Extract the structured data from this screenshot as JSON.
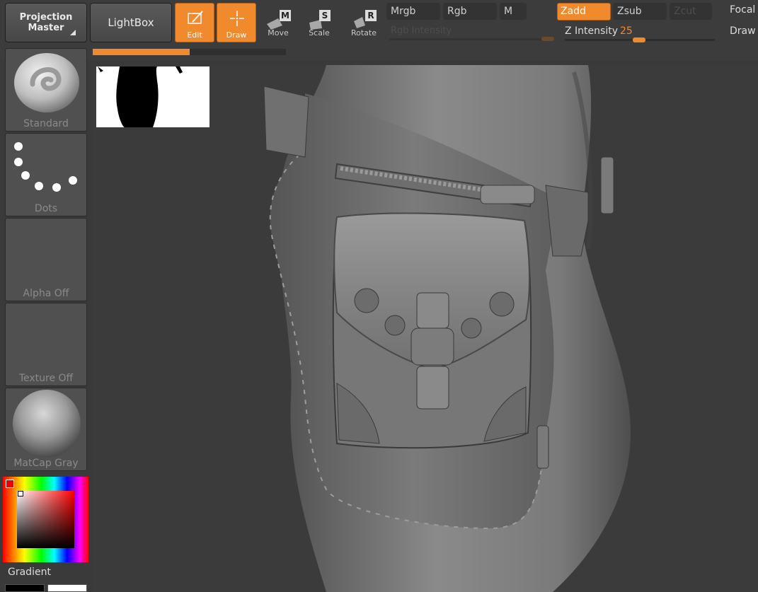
{
  "toolbar": {
    "projection_master_line1": "Projection",
    "projection_master_line2": "Master",
    "lightbox": "LightBox",
    "edit": "Edit",
    "draw": "Draw",
    "move": "Move",
    "move_key": "M",
    "scale": "Scale",
    "scale_key": "S",
    "rotate": "Rotate",
    "rotate_key": "R",
    "mrgb": "Mrgb",
    "rgb": "Rgb",
    "m": "M",
    "rgb_intensity": "Rgb Intensity",
    "zadd": "Zadd",
    "zsub": "Zsub",
    "zcut": "Zcut",
    "z_intensity_label": "Z Intensity",
    "z_intensity_value": "25",
    "focal": "Focal",
    "draw_size": "Draw"
  },
  "left_shelf": {
    "brush": "Standard",
    "stroke": "Dots",
    "alpha": "Alpha Off",
    "texture": "Texture Off",
    "material": "MatCap Gray",
    "gradient": "Gradient"
  },
  "colors": {
    "accent": "#f08a2c",
    "panel": "#3c3c3c",
    "viewport": "#3b3b3b"
  },
  "progress": {
    "fill": 0.5
  }
}
